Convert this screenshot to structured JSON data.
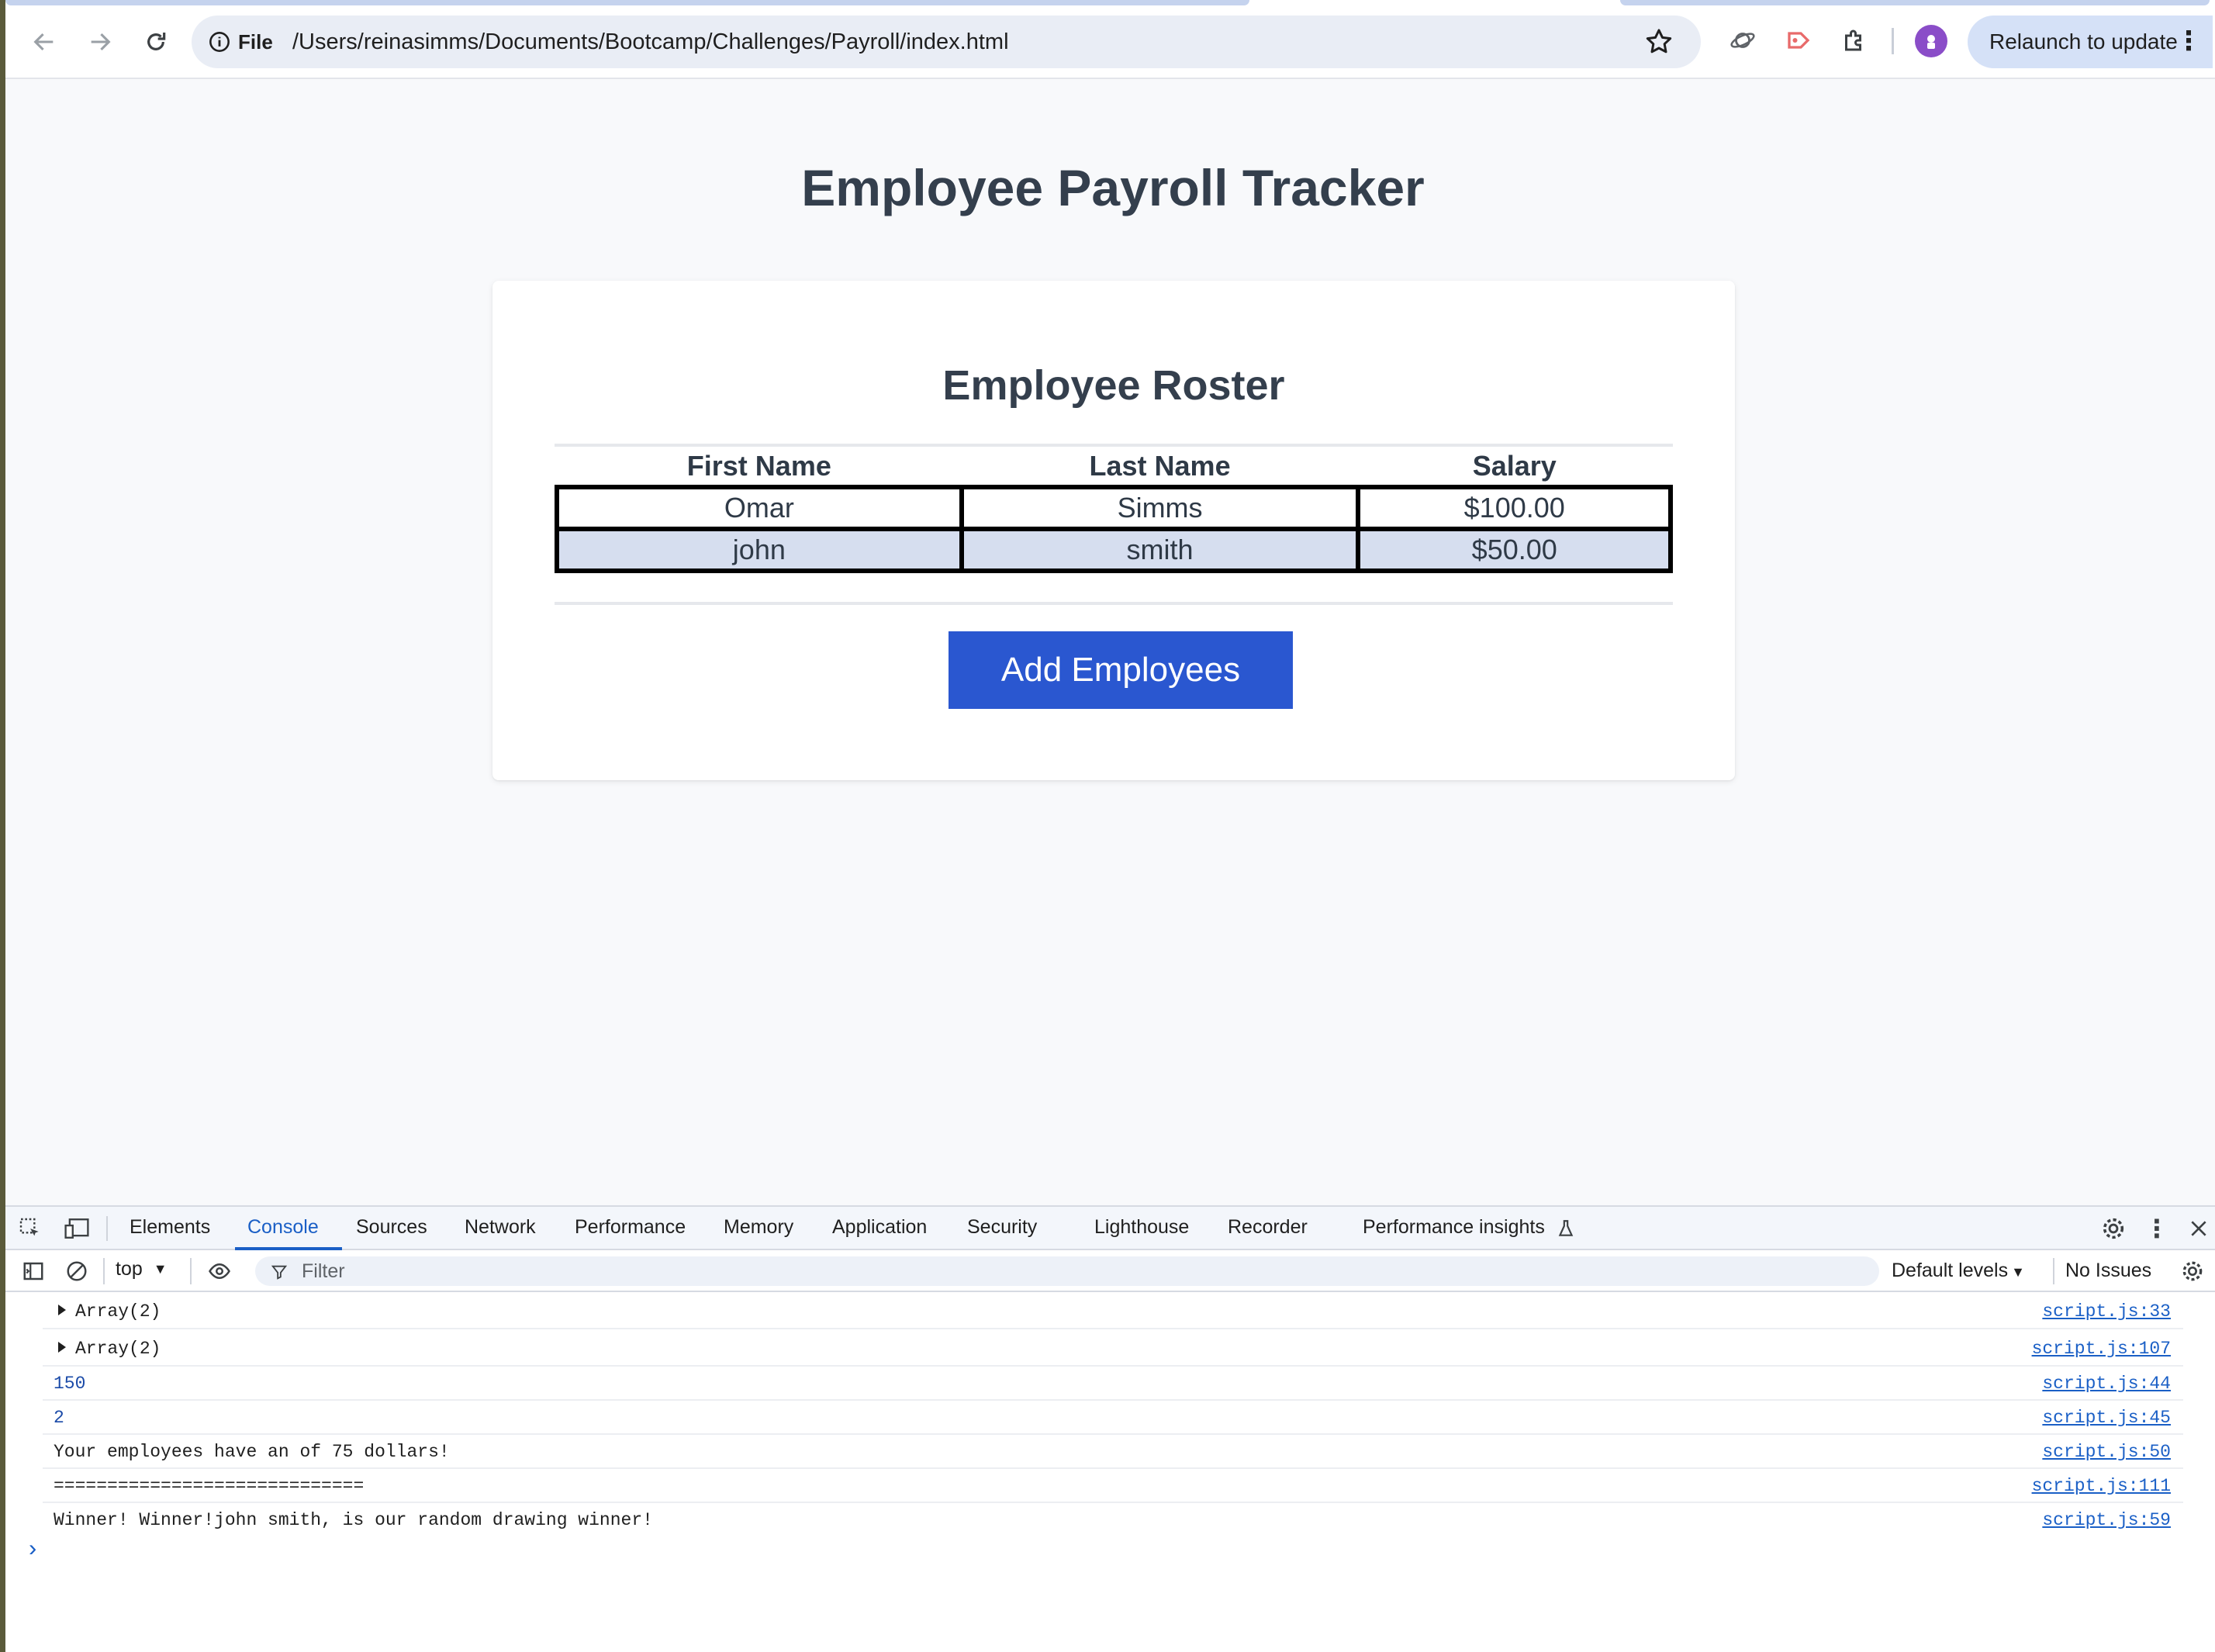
{
  "browser": {
    "site_chip": "File",
    "url": "/Users/reinasimms/Documents/Bootcamp/Challenges/Payroll/index.html",
    "relaunch_label": "Relaunch to update"
  },
  "page": {
    "title": "Employee Payroll Tracker",
    "card_title": "Employee Roster",
    "table": {
      "headers": [
        "First Name",
        "Last Name",
        "Salary"
      ],
      "rows": [
        [
          "Omar",
          "Simms",
          "$100.00"
        ],
        [
          "john",
          "smith",
          "$50.00"
        ]
      ]
    },
    "add_button_label": "Add Employees"
  },
  "devtools": {
    "tabs": [
      "Elements",
      "Console",
      "Sources",
      "Network",
      "Performance",
      "Memory",
      "Application",
      "Security",
      "Lighthouse",
      "Recorder",
      "Performance insights"
    ],
    "active_tab": "Console",
    "context": "top",
    "filter_placeholder": "Filter",
    "levels": "Default levels",
    "issues": "No Issues",
    "lines": [
      {
        "msg": "Array(2)",
        "src": "script.js:33"
      },
      {
        "msg": "Array(2)",
        "src": "script.js:107"
      },
      {
        "msg": "150",
        "src": "script.js:44"
      },
      {
        "msg": "2",
        "src": "script.js:45"
      },
      {
        "msg": "Your employees have an of 75 dollars!",
        "src": "script.js:50"
      },
      {
        "msg": "=============================",
        "src": "script.js:111"
      },
      {
        "msg": "Winner! Winner!john smith, is our random drawing winner!",
        "src": "script.js:59"
      }
    ]
  },
  "colors": {
    "accent": "#2a57d0",
    "row_alt": "#d6deef",
    "link": "#1a5fc6"
  }
}
